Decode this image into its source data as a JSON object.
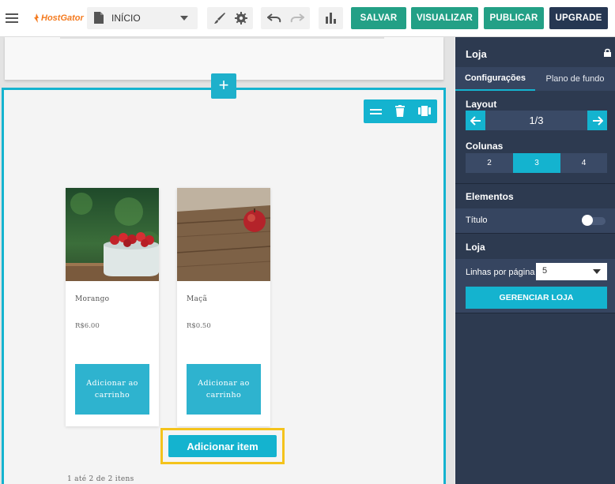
{
  "topbar": {
    "brand": "HostGator",
    "page_select": {
      "value": "INÍCIO"
    },
    "buttons": {
      "save": "SALVAR",
      "preview": "VISUALIZAR",
      "publish": "PUBLICAR",
      "upgrade": "UPGRADE"
    },
    "colors": {
      "green": "#23a086",
      "dark": "#263752",
      "brand": "#f47b20"
    }
  },
  "canvas": {
    "products": [
      {
        "name": "Morango",
        "price": "R$6.00",
        "cta": "Adicionar ao carrinho"
      },
      {
        "name": "Maçã",
        "price": "R$0.50",
        "cta": "Adicionar ao carrinho"
      }
    ],
    "add_item": "Adicionar item",
    "pager": "1 até 2 de 2 itens"
  },
  "panel": {
    "title": "Loja",
    "tabs": [
      "Configurações",
      "Plano de fundo"
    ],
    "layout": {
      "label": "Layout",
      "value": "1/3"
    },
    "columns": {
      "label": "Colunas",
      "options": [
        "2",
        "3",
        "4"
      ],
      "selected": "3"
    },
    "elements": {
      "label": "Elementos",
      "title_toggle": "Título",
      "title_enabled": false
    },
    "shop": {
      "label": "Loja",
      "lines_label": "Linhas por página",
      "lines_value": "5",
      "manage": "GERENCIAR LOJA"
    },
    "accent": "#14b3cf"
  }
}
